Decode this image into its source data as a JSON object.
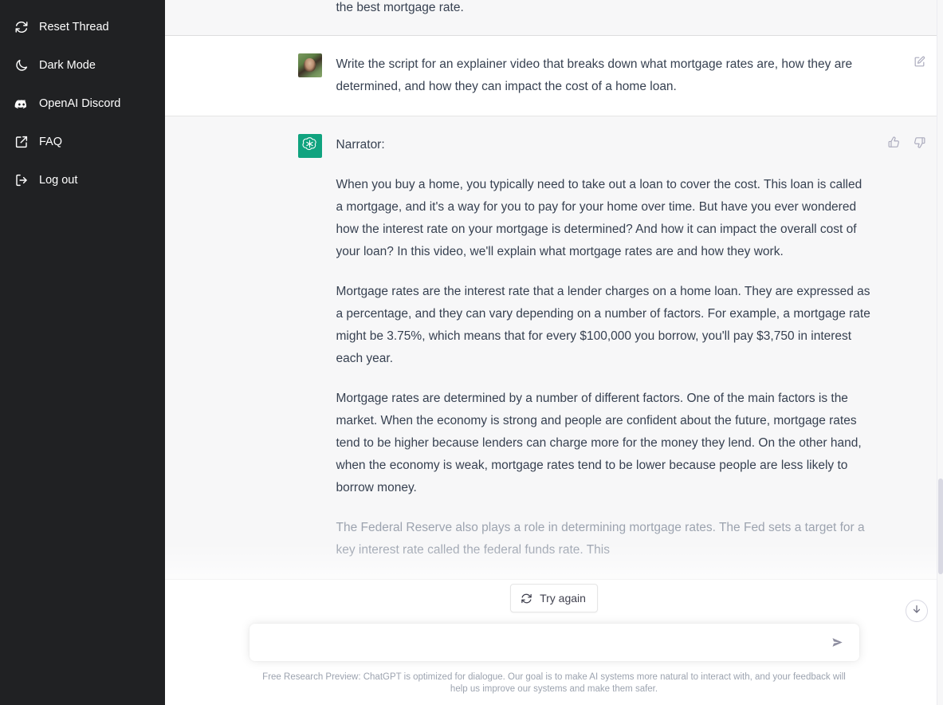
{
  "sidebar": {
    "items": [
      {
        "label": "Reset Thread",
        "icon": "reset-icon",
        "name": "sidebar-item-reset-thread"
      },
      {
        "label": "Dark Mode",
        "icon": "moon-icon",
        "name": "sidebar-item-dark-mode"
      },
      {
        "label": "OpenAI Discord",
        "icon": "discord-icon",
        "name": "sidebar-item-openai-discord"
      },
      {
        "label": "FAQ",
        "icon": "external-link-icon",
        "name": "sidebar-item-faq"
      },
      {
        "label": "Log out",
        "icon": "logout-icon",
        "name": "sidebar-item-log-out"
      }
    ]
  },
  "thread": {
    "clipped_message": {
      "role": "assistant",
      "visible_tail": "the best mortgage rate."
    },
    "messages": [
      {
        "role": "user",
        "avatar": "user-photo-avatar",
        "text": "Write the script for an explainer video that breaks down what mortgage rates are, how they are determined, and how they can impact the cost of a home loan.",
        "action_icons": [
          {
            "name": "edit-message-icon",
            "glyph": "pencil-square"
          }
        ]
      },
      {
        "role": "assistant",
        "avatar": "chatgpt-logo-avatar",
        "paragraphs": [
          "Narrator:",
          "When you buy a home, you typically need to take out a loan to cover the cost. This loan is called a mortgage, and it's a way for you to pay for your home over time. But have you ever wondered how the interest rate on your mortgage is determined? And how it can impact the overall cost of your loan? In this video, we'll explain what mortgage rates are and how they work.",
          "Mortgage rates are the interest rate that a lender charges on a home loan. They are expressed as a percentage, and they can vary depending on a number of factors. For example, a mortgage rate might be 3.75%, which means that for every $100,000 you borrow, you'll pay $3,750 in interest each year.",
          "Mortgage rates are determined by a number of different factors. One of the main factors is the market. When the economy is strong and people are confident about the future, mortgage rates tend to be higher because lenders can charge more for the money they lend. On the other hand, when the economy is weak, mortgage rates tend to be lower because people are less likely to borrow money.",
          "The Federal Reserve also plays a role in determining mortgage rates. The Fed sets a target for a key interest rate called the federal funds rate. This"
        ],
        "action_icons": [
          {
            "name": "thumbs-up-icon",
            "glyph": "thumbs-up"
          },
          {
            "name": "thumbs-down-icon",
            "glyph": "thumbs-down"
          }
        ]
      }
    ]
  },
  "try_again": {
    "label": "Try again",
    "icon": "refresh-icon"
  },
  "composer": {
    "value": "",
    "placeholder": "",
    "send_icon": "send-icon"
  },
  "scroll_to_bottom": {
    "icon": "arrow-down-circle-icon"
  },
  "footer": {
    "disclaimer": "Free Research Preview: ChatGPT is optimized for dialogue. Our goal is to make AI systems more natural to interact with, and your feedback will help us improve our systems and make them safer."
  },
  "colors": {
    "sidebar_bg": "#202123",
    "assistant_bg": "#f7f7f8",
    "user_bg": "#ffffff",
    "brand_green": "#10a37f",
    "text": "#374151",
    "muted_text": "#9ca3af"
  }
}
